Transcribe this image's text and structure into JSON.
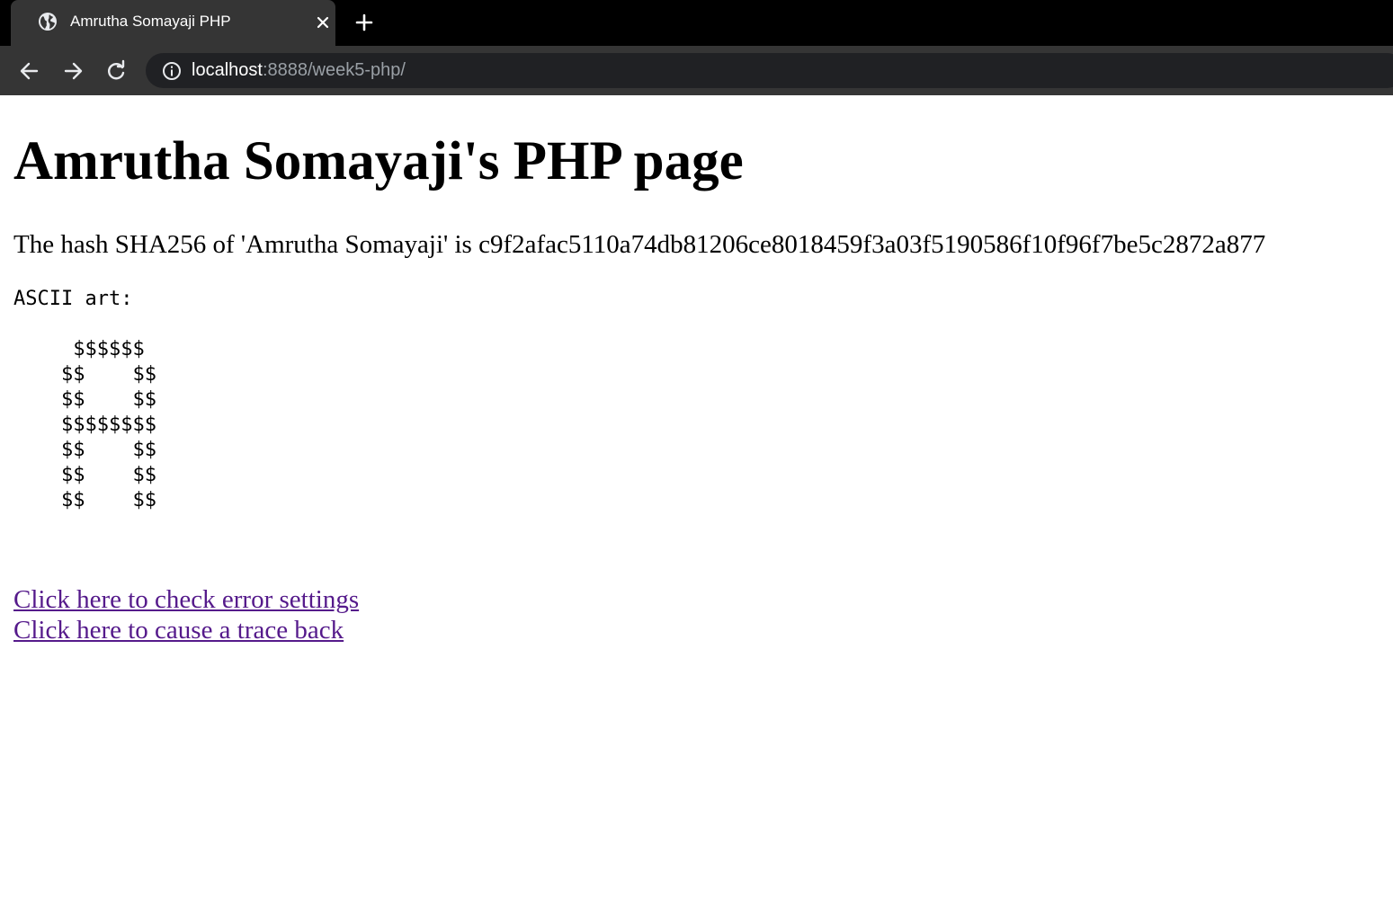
{
  "browser": {
    "tab": {
      "title": "Amrutha Somayaji PHP",
      "favicon": "globe-icon"
    },
    "address": {
      "host": "localhost",
      "rest": ":8888/week5-php/"
    },
    "colors": {
      "tab_strip": "#000000",
      "toolbar": "#353535",
      "omnibox": "#202124"
    }
  },
  "page": {
    "heading": "Amrutha Somayaji's PHP page",
    "hash_text": "The hash SHA256 of 'Amrutha Somayaji' is c9f2afac5110a74db81206ce8018459f3a03f5190586f10f96f7be5c2872a877",
    "ascii_art": "ASCII art:\n\n     $$$$$$\n    $$    $$\n    $$    $$\n    $$$$$$$$\n    $$    $$\n    $$    $$\n    $$    $$",
    "links": [
      {
        "label": "Click here to check error settings"
      },
      {
        "label": "Click here to cause a trace back"
      }
    ],
    "link_color": "#551a8b"
  }
}
